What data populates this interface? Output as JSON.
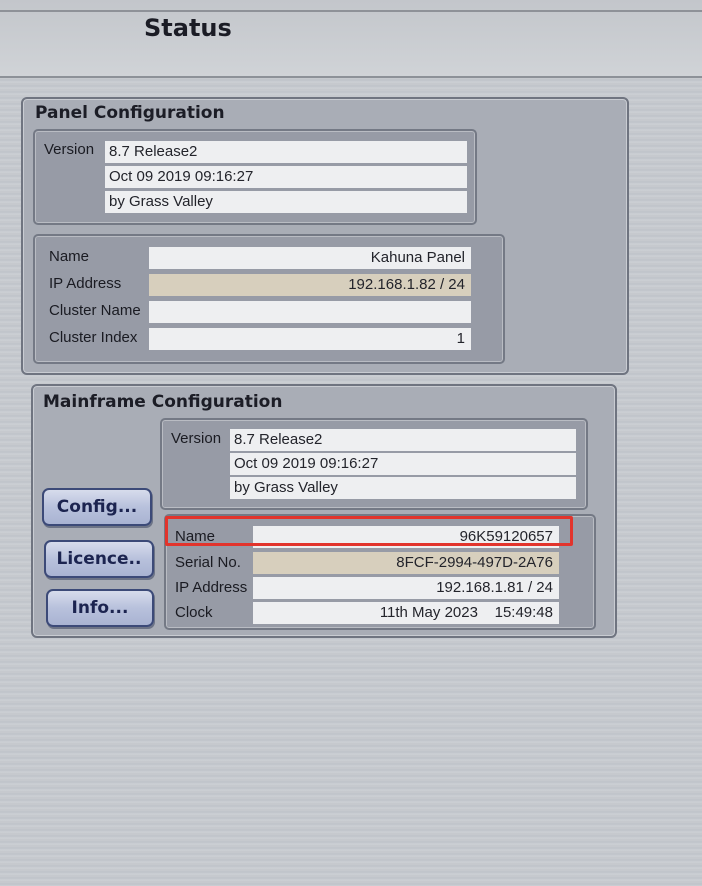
{
  "header": {
    "title": "Status"
  },
  "panel_config": {
    "title": "Panel Configuration",
    "version_label": "Version",
    "version_lines": [
      "8.7 Release2",
      "Oct 09 2019 09:16:27",
      "by Grass Valley"
    ],
    "fields": [
      {
        "label": "Name",
        "value": "Kahuna Panel"
      },
      {
        "label": "IP Address",
        "value": "192.168.1.82 / 24"
      },
      {
        "label": "Cluster Name",
        "value": ""
      },
      {
        "label": "Cluster Index",
        "value": "1"
      }
    ]
  },
  "mainframe_config": {
    "title": "Mainframe Configuration",
    "version_label": "Version",
    "version_lines": [
      "8.7 Release2",
      "Oct 09 2019 09:16:27",
      "by Grass Valley"
    ],
    "buttons": {
      "config": "Config...",
      "licence": "Licence..",
      "info": "Info..."
    },
    "fields": [
      {
        "label": "Name",
        "value": "96K59120657"
      },
      {
        "label": "Serial No.",
        "value": "8FCF-2994-497D-2A76"
      },
      {
        "label": "IP Address",
        "value": "192.168.1.81 / 24"
      },
      {
        "label": "Clock",
        "value": "11th May 2023    15:49:48"
      }
    ]
  },
  "colors": {
    "highlight": "#e2342c",
    "tan_field": "#d7cfbd",
    "button_text": "#1c2450"
  }
}
